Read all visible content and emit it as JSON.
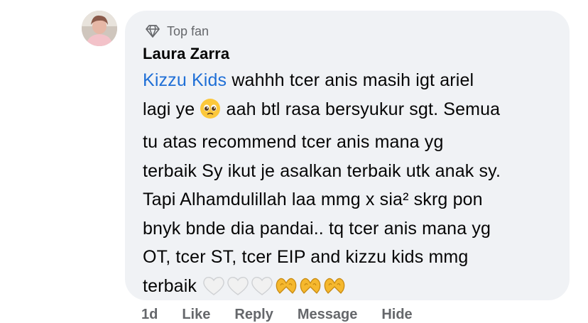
{
  "comment": {
    "badge_label": "Top fan",
    "author": "Laura Zarra",
    "mention": "Kizzu Kids",
    "lines": [
      " wahhh tcer anis masih igt ariel",
      "lagi ye ",
      " aah btl rasa bersyukur sgt. Semua",
      "tu atas recommend tcer anis mana yg",
      "terbaik Sy ikut je asalkan terbaik utk anak sy.",
      "Tapi Alhamdulillah laa mmg x sia² skrg pon",
      "bnyk bnde dia pandai.. tq tcer anis mana yg",
      "OT, tcer  ST, tcer EIP and kizzu kids mmg",
      "terbaik "
    ],
    "inline_emoji": "pleading-face",
    "trailing_emoji": [
      "white-heart",
      "white-heart",
      "white-heart",
      "heart-hands",
      "heart-hands",
      "heart-hands"
    ]
  },
  "actions": {
    "time": "1d",
    "like": "Like",
    "reply": "Reply",
    "message": "Message",
    "hide": "Hide"
  },
  "colors": {
    "bubble": "#f0f2f5",
    "mention": "#1f6fd6",
    "secondary_text": "#65676b"
  }
}
